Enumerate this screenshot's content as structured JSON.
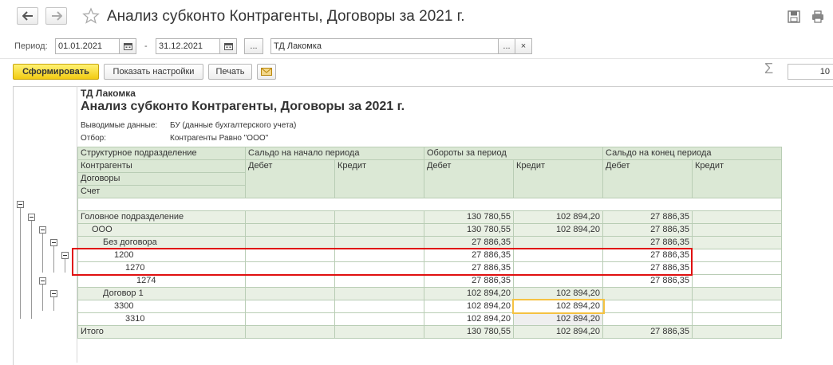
{
  "window": {
    "title": "Анализ субконто Контрагенты, Договоры  за 2021 г."
  },
  "period": {
    "label": "Период:",
    "from": "01.01.2021",
    "to": "31.12.2021",
    "dash": "-",
    "more_label": "...",
    "org": "ТД Лакомка",
    "org_more": "...",
    "org_clear": "×"
  },
  "toolbar": {
    "generate_label": "Сформировать",
    "settings_label": "Показать настройки",
    "print_label": "Печать",
    "sum_value": "10",
    "sigma": "Σ"
  },
  "report": {
    "company": "ТД Лакомка",
    "title": "Анализ субконто Контрагенты, Договоры  за 2021 г.",
    "output_label": "Выводимые данные:",
    "output_value": "БУ (данные бухгалтерского учета)",
    "filter_label": "Отбор:",
    "filter_value": "Контрагенты Равно \"ООО\"",
    "headers": {
      "dim1": "Структурное подразделение",
      "dim2": "Контрагенты",
      "dim3": "Договоры",
      "dim4": "Счет",
      "open": "Сальдо на начало периода",
      "turnover": "Обороты за период",
      "close": "Сальдо на конец периода",
      "debit": "Дебет",
      "credit": "Кредит"
    },
    "rows": [
      {
        "name": "Головное подразделение",
        "open_d": "",
        "open_c": "",
        "turn_d": "130 780,55",
        "turn_c": "102 894,20",
        "close_d": "27 886,35",
        "close_c": ""
      },
      {
        "name": "ООО",
        "open_d": "",
        "open_c": "",
        "turn_d": "130 780,55",
        "turn_c": "102 894,20",
        "close_d": "27 886,35",
        "close_c": ""
      },
      {
        "name": "Без договора",
        "open_d": "",
        "open_c": "",
        "turn_d": "27 886,35",
        "turn_c": "",
        "close_d": "27 886,35",
        "close_c": ""
      },
      {
        "name": "1200",
        "open_d": "",
        "open_c": "",
        "turn_d": "27 886,35",
        "turn_c": "",
        "close_d": "27 886,35",
        "close_c": ""
      },
      {
        "name": "1270",
        "open_d": "",
        "open_c": "",
        "turn_d": "27 886,35",
        "turn_c": "",
        "close_d": "27 886,35",
        "close_c": ""
      },
      {
        "name": "1274",
        "open_d": "",
        "open_c": "",
        "turn_d": "27 886,35",
        "turn_c": "",
        "close_d": "27 886,35",
        "close_c": ""
      },
      {
        "name": "Договор 1",
        "open_d": "",
        "open_c": "",
        "turn_d": "102 894,20",
        "turn_c": "102 894,20",
        "close_d": "",
        "close_c": ""
      },
      {
        "name": "3300",
        "open_d": "",
        "open_c": "",
        "turn_d": "102 894,20",
        "turn_c": "102 894,20",
        "close_d": "",
        "close_c": ""
      },
      {
        "name": "3310",
        "open_d": "",
        "open_c": "",
        "turn_d": "102 894,20",
        "turn_c": "102 894,20",
        "close_d": "",
        "close_c": ""
      }
    ],
    "total": {
      "name": "Итого",
      "open_d": "",
      "open_c": "",
      "turn_d": "130 780,55",
      "turn_c": "102 894,20",
      "close_d": "27 886,35",
      "close_c": ""
    }
  },
  "icons": [
    "back-arrow-icon",
    "forward-arrow-icon",
    "star-icon",
    "save-icon",
    "print-icon",
    "calendar-icon",
    "email-icon",
    "sigma-icon"
  ],
  "colors": {
    "header_green": "#dbe8d5",
    "row_green": "#e9f0e4",
    "primary_button": "#f2cb12",
    "highlight_red": "#e01010",
    "selection": "#f5c242"
  }
}
